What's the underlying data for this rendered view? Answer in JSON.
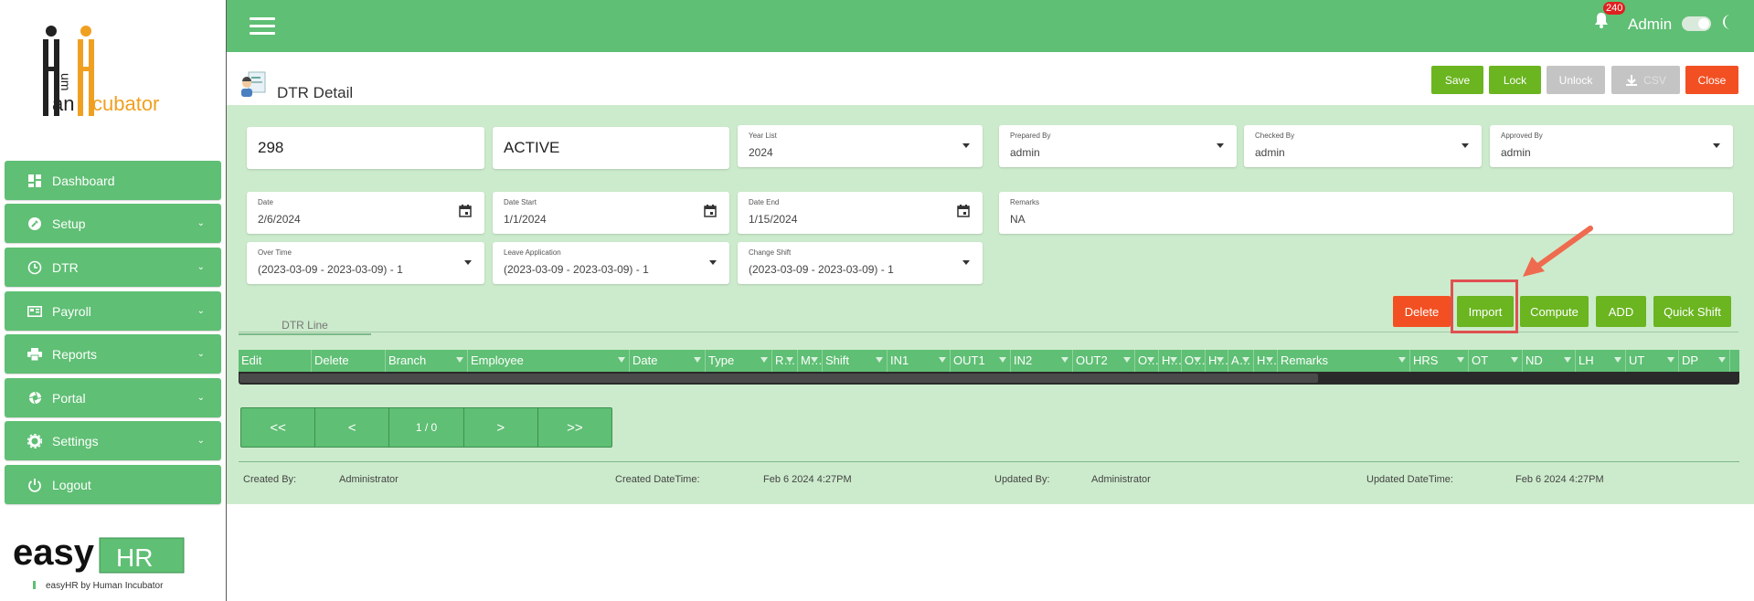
{
  "sidebar": {
    "logo_letters": "human incubator",
    "items": [
      {
        "label": "Dashboard",
        "icon": "dashboard-icon",
        "has_chevron": false
      },
      {
        "label": "Setup",
        "icon": "wrench-icon",
        "has_chevron": true
      },
      {
        "label": "DTR",
        "icon": "clock-icon",
        "has_chevron": true
      },
      {
        "label": "Payroll",
        "icon": "payroll-icon",
        "has_chevron": true
      },
      {
        "label": "Reports",
        "icon": "printer-icon",
        "has_chevron": true
      },
      {
        "label": "Portal",
        "icon": "aperture-icon",
        "has_chevron": true
      },
      {
        "label": "Settings",
        "icon": "gear-icon",
        "has_chevron": true
      },
      {
        "label": "Logout",
        "icon": "power-icon",
        "has_chevron": false
      }
    ],
    "brand_main": "easy",
    "brand_badge": "HR",
    "brand_caption": "easyHR by Human Incubator"
  },
  "topbar": {
    "notification_count": "240",
    "user": "Admin"
  },
  "header": {
    "title": "DTR Detail",
    "buttons": {
      "save": "Save",
      "lock": "Lock",
      "unlock": "Unlock",
      "csv": "CSV",
      "close": "Close"
    }
  },
  "form": {
    "id_value": "298",
    "status_value": "ACTIVE",
    "year_list": {
      "label": "Year List",
      "value": "2024"
    },
    "prepared_by": {
      "label": "Prepared By",
      "value": "admin"
    },
    "checked_by": {
      "label": "Checked By",
      "value": "admin"
    },
    "approved_by": {
      "label": "Approved By",
      "value": "admin"
    },
    "date": {
      "label": "Date",
      "value": "2/6/2024"
    },
    "date_start": {
      "label": "Date Start",
      "value": "1/1/2024"
    },
    "date_end": {
      "label": "Date End",
      "value": "1/15/2024"
    },
    "remarks": {
      "label": "Remarks",
      "value": "NA"
    },
    "over_time": {
      "label": "Over Time",
      "value": "(2023-03-09 - 2023-03-09) - 1"
    },
    "leave_application": {
      "label": "Leave Application",
      "value": "(2023-03-09 - 2023-03-09) - 1"
    },
    "change_shift": {
      "label": "Change Shift",
      "value": "(2023-03-09 - 2023-03-09) - 1"
    }
  },
  "tabs": {
    "dtr_line": "DTR Line"
  },
  "actions": {
    "delete": "Delete",
    "import": "Import",
    "compute": "Compute",
    "add": "ADD",
    "quick_shift": "Quick Shift"
  },
  "grid": {
    "columns": [
      "Edit",
      "Delete",
      "Branch",
      "Employee",
      "Date",
      "Type",
      "R…",
      "M…",
      "Shift",
      "IN1",
      "OUT1",
      "IN2",
      "OUT2",
      "O…",
      "H…",
      "O…",
      "H…",
      "A…",
      "H…",
      "Remarks",
      "HRS",
      "OT",
      "ND",
      "LH",
      "UT",
      "DP"
    ]
  },
  "pager": {
    "first": "<<",
    "prev": "<",
    "info": "1 / 0",
    "next": ">",
    "last": ">>"
  },
  "footer": {
    "created_by_label": "Created By:",
    "created_by_value": "Administrator",
    "created_dt_label": "Created DateTime:",
    "created_dt_value": "Feb 6 2024 4:27PM",
    "updated_by_label": "Updated By:",
    "updated_by_value": "Administrator",
    "updated_dt_label": "Updated DateTime:",
    "updated_dt_value": "Feb 6 2024 4:27PM"
  },
  "colors": {
    "primary_green": "#5fbf74",
    "content_bg": "#ccebcc",
    "action_green": "#6ab520",
    "danger": "#f25022",
    "disabled": "#c4c4c4"
  }
}
